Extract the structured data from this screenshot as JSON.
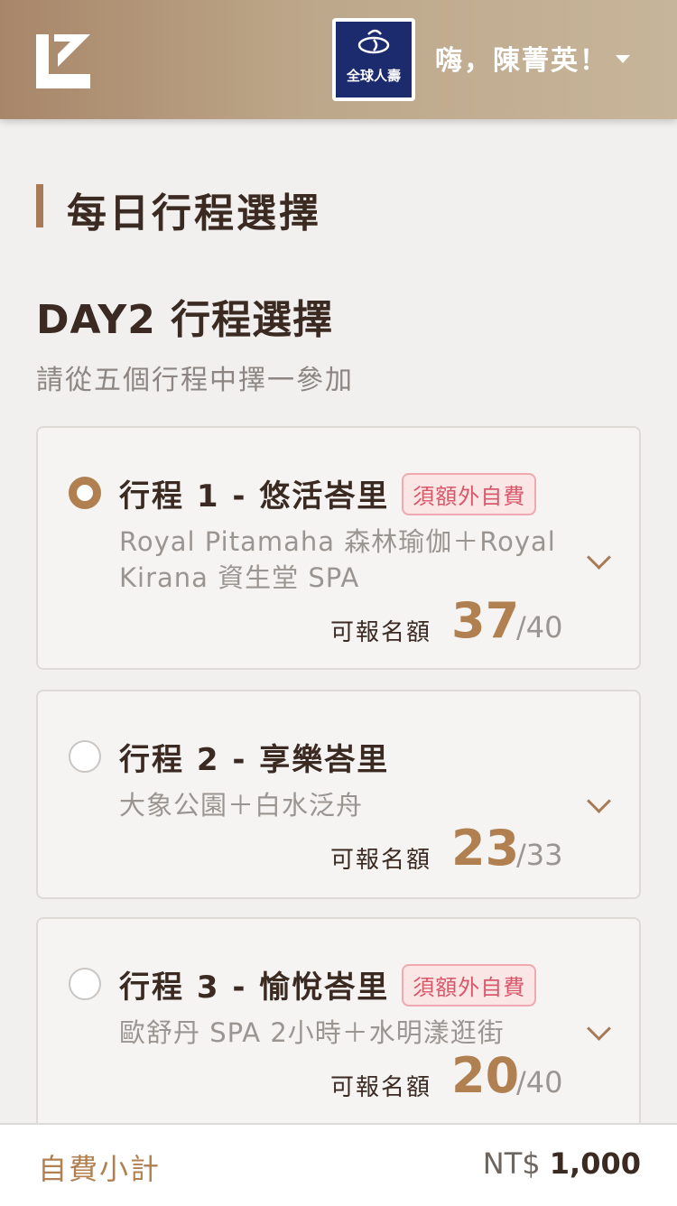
{
  "header": {
    "brand_name": "全球人壽",
    "greeting": "嗨，陳菁英！",
    "colors": {
      "gradient_start": "#a88669",
      "gradient_end": "#c7b59a",
      "brand_blue": "#1c2a6e"
    }
  },
  "page_title": "每日行程選擇",
  "day_title": "DAY2 行程選擇",
  "subtitle": "請從五個行程中擇一參加",
  "quota_label": "可報名額",
  "itineraries": [
    {
      "title": "行程 1 - 悠活峇里",
      "badge": "須額外自費",
      "description": "Royal Pitamaha 森林瑜伽＋Royal Kirana 資生堂 SPA",
      "available": "37",
      "total": "/40",
      "selected": true
    },
    {
      "title": "行程 2 - 享樂峇里",
      "badge": "",
      "description": "大象公園＋白水泛舟",
      "available": "23",
      "total": "/33",
      "selected": false
    },
    {
      "title": "行程 3 - 愉悅峇里",
      "badge": "須額外自費",
      "description": "歐舒丹 SPA 2小時＋水明漾逛街",
      "available": "20",
      "total": "/40",
      "selected": false
    }
  ],
  "footer": {
    "label": "自費小計",
    "currency": "NT$",
    "amount": "1,000"
  },
  "icons": [
    "app-logo-icon",
    "radio-icon",
    "chevron-down-icon",
    "caret-down-icon"
  ],
  "accent_color": "#b08050",
  "badge_color": "#d8586a"
}
